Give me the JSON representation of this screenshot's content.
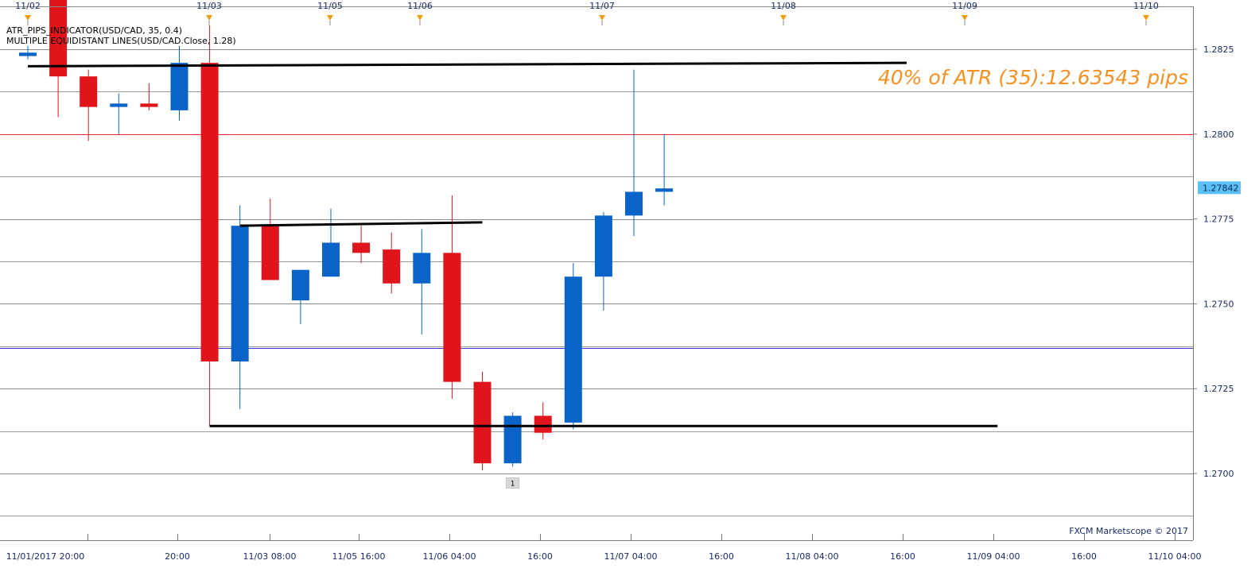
{
  "chart_data": {
    "type": "candlestick",
    "indicators": [
      "ATR_PIPS_INDICATOR(USD/CAD, 35, 0.4)",
      "MULTIPLE EQUIDISTANT LINES(USD/CAD.Close, 1.28)"
    ],
    "atr_label": "40% of ATR (35):12.63543 pips",
    "watermark": "FXCM Marketscope © 2017",
    "current_price_label": "1.27842",
    "current_price": 1.27842,
    "ylim": [
      1.2677,
      1.2848
    ],
    "y_ticks": [
      "1.2825",
      "1.2800",
      "1.2775",
      "1.2750",
      "1.2725",
      "1.2700"
    ],
    "y_tick_values": [
      1.2825,
      1.28,
      1.2775,
      1.275,
      1.2725,
      1.27
    ],
    "minor_grid_values": [
      1.28125,
      1.27875,
      1.27625,
      1.27375,
      1.27125,
      1.26875
    ],
    "x_ticks": [
      "11/01/2017 20:00",
      "20:00",
      "11/03 08:00",
      "11/05 16:00",
      "11/06 04:00",
      "16:00",
      "11/07 04:00",
      "16:00",
      "11/08 04:00",
      "16:00",
      "11/09 04:00",
      "16:00",
      "11/10 04:00"
    ],
    "top_markers": [
      "11/02",
      "11/03",
      "11/05",
      "11/06",
      "11/07",
      "11/08",
      "11/09",
      "11/10"
    ],
    "candles": [
      {
        "open": 1.2823,
        "high": 1.2826,
        "low": 1.2822,
        "close": 1.2824,
        "color": "blue"
      },
      {
        "open": 1.2848,
        "high": 1.2848,
        "low": 1.2805,
        "close": 1.2817,
        "color": "red"
      },
      {
        "open": 1.2817,
        "high": 1.2819,
        "low": 1.2798,
        "close": 1.2808,
        "color": "red"
      },
      {
        "open": 1.2808,
        "high": 1.2812,
        "low": 1.28,
        "close": 1.2809,
        "color": "blue"
      },
      {
        "open": 1.2809,
        "high": 1.2815,
        "low": 1.2807,
        "close": 1.2808,
        "color": "red"
      },
      {
        "open": 1.2807,
        "high": 1.2826,
        "low": 1.2804,
        "close": 1.2821,
        "color": "blue"
      },
      {
        "open": 1.2821,
        "high": 1.2832,
        "low": 1.2714,
        "close": 1.2733,
        "color": "red"
      },
      {
        "open": 1.2733,
        "high": 1.2779,
        "low": 1.2719,
        "close": 1.2773,
        "color": "blue"
      },
      {
        "open": 1.2773,
        "high": 1.2781,
        "low": 1.2757,
        "close": 1.2757,
        "color": "red"
      },
      {
        "open": 1.2751,
        "high": 1.276,
        "low": 1.2744,
        "close": 1.276,
        "color": "blue"
      },
      {
        "open": 1.2758,
        "high": 1.2778,
        "low": 1.2758,
        "close": 1.2768,
        "color": "blue"
      },
      {
        "open": 1.2768,
        "high": 1.2773,
        "low": 1.2762,
        "close": 1.2765,
        "color": "red"
      },
      {
        "open": 1.2766,
        "high": 1.2771,
        "low": 1.2753,
        "close": 1.2756,
        "color": "red"
      },
      {
        "open": 1.2756,
        "high": 1.2772,
        "low": 1.2741,
        "close": 1.2765,
        "color": "blue"
      },
      {
        "open": 1.2765,
        "high": 1.2782,
        "low": 1.2722,
        "close": 1.2727,
        "color": "red"
      },
      {
        "open": 1.2727,
        "high": 1.273,
        "low": 1.2701,
        "close": 1.2703,
        "color": "red"
      },
      {
        "open": 1.2703,
        "high": 1.2718,
        "low": 1.2702,
        "close": 1.2717,
        "color": "blue"
      },
      {
        "open": 1.2717,
        "high": 1.2721,
        "low": 1.271,
        "close": 1.2712,
        "color": "red"
      },
      {
        "open": 1.2715,
        "high": 1.2762,
        "low": 1.2713,
        "close": 1.2758,
        "color": "blue"
      },
      {
        "open": 1.2758,
        "high": 1.2777,
        "low": 1.2748,
        "close": 1.2776,
        "color": "blue"
      },
      {
        "open": 1.2776,
        "high": 1.2819,
        "low": 1.277,
        "close": 1.2783,
        "color": "blue"
      },
      {
        "open": 1.2783,
        "high": 1.28,
        "low": 1.2779,
        "close": 1.2784,
        "color": "blue"
      }
    ],
    "horizontal_levels": [
      {
        "value": 1.28,
        "color": "#e8232a"
      },
      {
        "value": 1.2737,
        "color": "#3b35d1"
      }
    ],
    "trend_lines": [
      {
        "from_candle": 0,
        "to_candle": 29,
        "y1": 1.282,
        "y2": 1.2821
      },
      {
        "from_candle": 7,
        "to_candle": 15,
        "y1": 1.2773,
        "y2": 1.2774
      },
      {
        "from_candle": 6,
        "to_candle": 32,
        "y1": 1.2714,
        "y2": 1.2714
      }
    ],
    "bar_marker": {
      "label": "1",
      "candle": 16
    },
    "colors": {
      "up": "#0a64c8",
      "down": "#e0141b",
      "grid": "#8a8a8a",
      "axis_text": "#1a2b6b",
      "marker": "#f39c12"
    },
    "grid": true
  }
}
